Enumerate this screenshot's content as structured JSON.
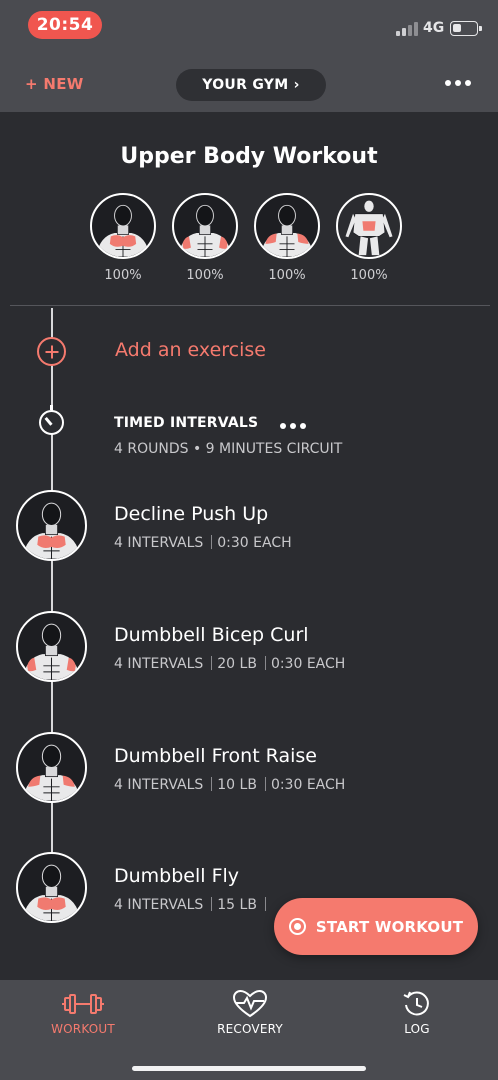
{
  "status_bar": {
    "time": "20:54",
    "network": "4G",
    "icons": [
      "signal-icon",
      "battery-icon"
    ]
  },
  "header": {
    "new_label": "+ NEW",
    "gym_label": "YOUR GYM ›",
    "more_icon": "more-horizontal-icon"
  },
  "workout": {
    "title": "Upper Body Workout",
    "muscle_groups": [
      {
        "icon": "chest-muscle-icon",
        "percent": "100%"
      },
      {
        "icon": "biceps-muscle-icon",
        "percent": "100%"
      },
      {
        "icon": "shoulders-muscle-icon",
        "percent": "100%"
      },
      {
        "icon": "back-muscle-icon",
        "percent": "100%"
      }
    ]
  },
  "add_exercise": {
    "label": "Add an exercise",
    "icon": "add-circle-icon"
  },
  "intervals": {
    "title": "TIMED INTERVALS",
    "subtitle": "4 ROUNDS • 9 MINUTES CIRCUIT",
    "icon": "timer-icon"
  },
  "exercises": [
    {
      "name": "Decline Push Up",
      "intervals": "4 INTERVALS",
      "weight": "",
      "each": "0:30 EACH",
      "icon": "chest-muscle-icon"
    },
    {
      "name": "Dumbbell Bicep Curl",
      "intervals": "4 INTERVALS",
      "weight": "20 LB",
      "each": "0:30 EACH",
      "icon": "biceps-muscle-icon"
    },
    {
      "name": "Dumbbell Front Raise",
      "intervals": "4 INTERVALS",
      "weight": "10 LB",
      "each": "0:30 EACH",
      "icon": "shoulders-muscle-icon"
    },
    {
      "name": "Dumbbell Fly",
      "intervals": "4 INTERVALS",
      "weight": "15 LB",
      "each": "",
      "icon": "chest-muscle-icon"
    }
  ],
  "start_button": {
    "label": "START WORKOUT",
    "icon": "record-icon"
  },
  "tabs": [
    {
      "label": "WORKOUT",
      "icon": "dumbbell-icon",
      "active": true
    },
    {
      "label": "RECOVERY",
      "icon": "heart-pulse-icon",
      "active": false
    },
    {
      "label": "LOG",
      "icon": "clock-history-icon",
      "active": false
    }
  ],
  "colors": {
    "accent": "#f57a6e",
    "status_red": "#f0564f",
    "background": "#2b2c30",
    "bar": "#4a4b50"
  }
}
